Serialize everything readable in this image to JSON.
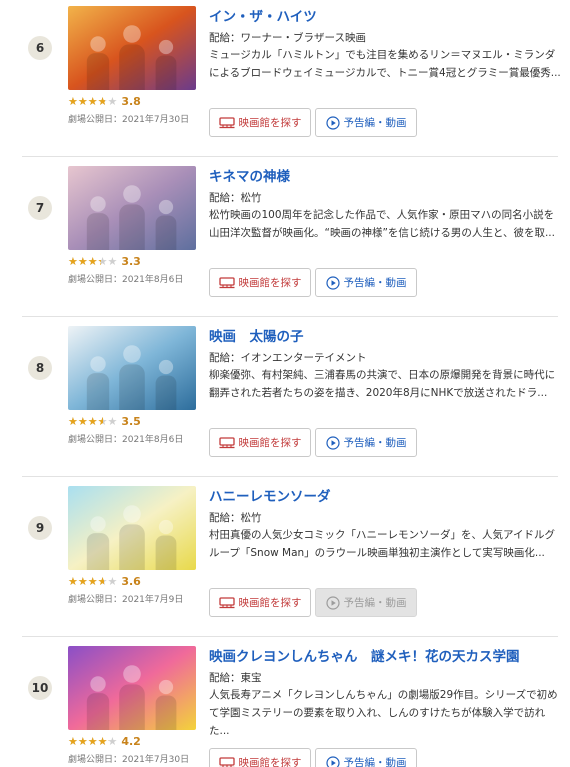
{
  "buttons": {
    "theater_label": "映画館を探す",
    "trailer_label": "予告編・動画"
  },
  "movies": [
    {
      "rank": "6",
      "title": "イン・ザ・ハイツ",
      "distributor": "配給：ワーナー・ブラザース映画",
      "description": "ミュージカル「ハミルトン」でも注目を集めるリン＝マヌエル・ミランダによるブロードウェイミュージカルで、トニー賞4冠とグラミー賞最優秀...",
      "rating": 3.8,
      "rating_text": "3.8",
      "release": "劇場公開日：2021年7月30日",
      "trailer_available": true,
      "poster_colors": [
        "#f2b34a",
        "#d8541e",
        "#6a3b8c"
      ]
    },
    {
      "rank": "7",
      "title": "キネマの神様",
      "distributor": "配給：松竹",
      "description": "松竹映画の100周年を記念した作品で、人気作家・原田マハの同名小説を山田洋次監督が映画化。“映画の神様”を信じ続ける男の人生と、彼を取...",
      "rating": 3.3,
      "rating_text": "3.3",
      "release": "劇場公開日：2021年8月6日",
      "trailer_available": true,
      "poster_colors": [
        "#e7c6cf",
        "#a98fb8",
        "#5e6f9e"
      ]
    },
    {
      "rank": "8",
      "title": "映画　太陽の子",
      "distributor": "配給：イオンエンターテイメント",
      "description": "柳楽優弥、有村架純、三浦春馬の共演で、日本の原爆開発を背景に時代に翻弄された若者たちの姿を描き、2020年8月にNHKで放送されたドラ...",
      "rating": 3.5,
      "rating_text": "3.5",
      "release": "劇場公開日：2021年8月6日",
      "trailer_available": true,
      "poster_colors": [
        "#eef3f6",
        "#7fb6d8",
        "#2d6d9c"
      ]
    },
    {
      "rank": "9",
      "title": "ハニーレモンソーダ",
      "distributor": "配給：松竹",
      "description": "村田真優の人気少女コミック「ハニーレモンソーダ」を、人気アイドルグループ「Snow Man」のラウール映画単独初主演作として実写映画化...",
      "rating": 3.6,
      "rating_text": "3.6",
      "release": "劇場公開日：2021年7月9日",
      "trailer_available": false,
      "poster_colors": [
        "#a9dff0",
        "#f6f1c4",
        "#e8d94a"
      ]
    },
    {
      "rank": "10",
      "title": "映画クレヨンしんちゃん　謎メキ！花の天カス学園",
      "distributor": "配給：東宝",
      "description": "人気長寿アニメ「クレヨンしんちゃん」の劇場版29作目。シリーズで初めて学園ミステリーの要素を取り入れ、しんのすけたちが体験入学で訪れた...",
      "rating": 4.2,
      "rating_text": "4.2",
      "release": "劇場公開日：2021年7月30日",
      "trailer_available": true,
      "poster_colors": [
        "#8a4fc7",
        "#f06a9a",
        "#f3d33a"
      ]
    }
  ]
}
